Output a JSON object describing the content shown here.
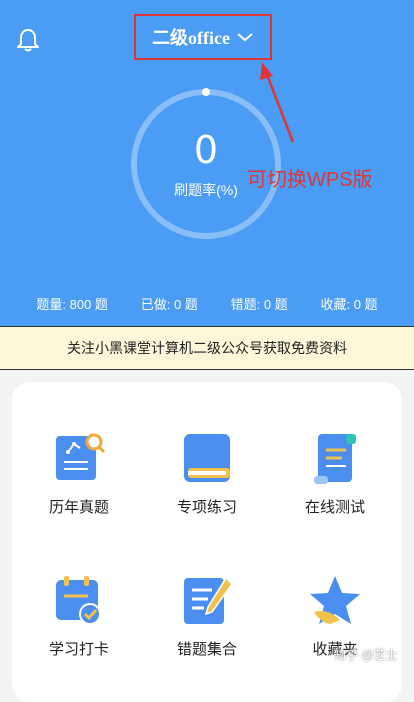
{
  "header": {
    "subject_label": "二级office",
    "rate_value": "0",
    "rate_label": "刷题率(%)",
    "annotation": "可切换WPS版",
    "stats": [
      {
        "text": "题量: 800 题"
      },
      {
        "text": "已做: 0 题"
      },
      {
        "text": "错题: 0 题"
      },
      {
        "text": "收藏: 0 题"
      }
    ]
  },
  "banner": {
    "text": "关注小黑课堂计算机二级公众号获取免费资料"
  },
  "grid": [
    {
      "label": "历年真题",
      "icon": "past-exam-icon"
    },
    {
      "label": "专项练习",
      "icon": "book-icon"
    },
    {
      "label": "在线测试",
      "icon": "scroll-icon"
    },
    {
      "label": "学习打卡",
      "icon": "calendar-check-icon"
    },
    {
      "label": "错题集合",
      "icon": "notes-pencil-icon"
    },
    {
      "label": "收藏夹",
      "icon": "star-icon"
    }
  ],
  "watermark": "知乎 @芝士",
  "colors": {
    "header_blue": "#4a9cf5",
    "annotation_red": "#e03535",
    "banner_bg": "#fdf6d8"
  }
}
